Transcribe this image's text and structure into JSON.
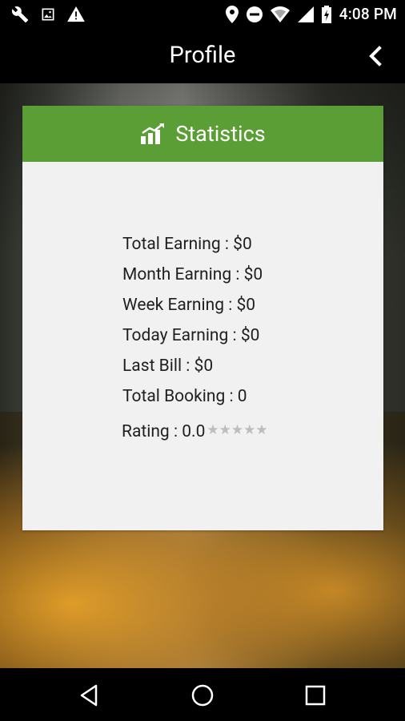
{
  "status_bar": {
    "time": "4:08 PM",
    "left_icons": [
      "wrench-icon",
      "image-icon",
      "warning-icon"
    ],
    "right_icons": [
      "location-icon",
      "do-not-disturb-icon",
      "wifi-icon",
      "signal-icon",
      "battery-icon"
    ]
  },
  "header": {
    "title": "Profile",
    "back_icon": "chevron-left-icon"
  },
  "card": {
    "title": "Statistics",
    "title_icon": "bar-chart-icon",
    "accent_color": "#5a9e35",
    "stats": [
      "Total Earning : $0",
      "Month Earning : $0",
      "Week Earning : $0",
      "Today Earning : $0",
      "Last Bill : $0",
      "Total Booking : 0"
    ],
    "rating_label": "Rating : 0.0",
    "rating_value": 0.0,
    "rating_max": 5
  },
  "nav_bar": {
    "buttons": [
      "back-triangle-icon",
      "home-circle-icon",
      "recents-square-icon"
    ]
  }
}
